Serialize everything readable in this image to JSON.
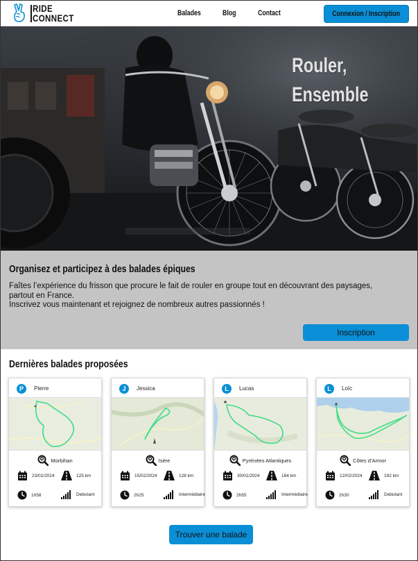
{
  "header": {
    "logo_line1": "RIDE",
    "logo_line2": "CONNECT",
    "nav": [
      "Balades",
      "Blog",
      "Contact"
    ],
    "login_label": "Connexion / Inscription"
  },
  "hero": {
    "title_line1": "Rouler,",
    "title_line2": "Ensemble"
  },
  "intro": {
    "title": "Organisez et participez à des balades épiques",
    "text_line1": "Faîtes l’expérience du frisson que procure le fait de rouler en groupe tout en découvrant des paysages, partout en France.",
    "text_line2": "Inscrivez vous maintenant et rejoignez de nombreux autres passionnés !",
    "signup_label": "Inscription"
  },
  "latest": {
    "title": "Dernières balades proposées",
    "find_label": "Trouver une balade",
    "cards": [
      {
        "initial": "P",
        "user": "Pierre",
        "location": "Morbihan",
        "date": "23/01/2024",
        "distance": "125 km",
        "duration": "1h58",
        "level": "Debutant"
      },
      {
        "initial": "J",
        "user": "Jessica",
        "location": "Isère",
        "date": "15/02/2024",
        "distance": "128 km",
        "duration": "2h25",
        "level": "Intermédiaire"
      },
      {
        "initial": "L",
        "user": "Lucas",
        "location": "Pyrénées Atlantiques",
        "date": "30/01/2024",
        "distance": "164 km",
        "duration": "2h55",
        "level": "Intermédiaire"
      },
      {
        "initial": "L",
        "user": "Loïc",
        "location": "Côtes d’Armor",
        "date": "12/02/2024",
        "distance": "192 km",
        "duration": "2h30",
        "level": "Debutant"
      }
    ]
  },
  "colors": {
    "accent": "#0a8fd6",
    "band": "#c4c4c4",
    "route": "#3ddc84"
  }
}
